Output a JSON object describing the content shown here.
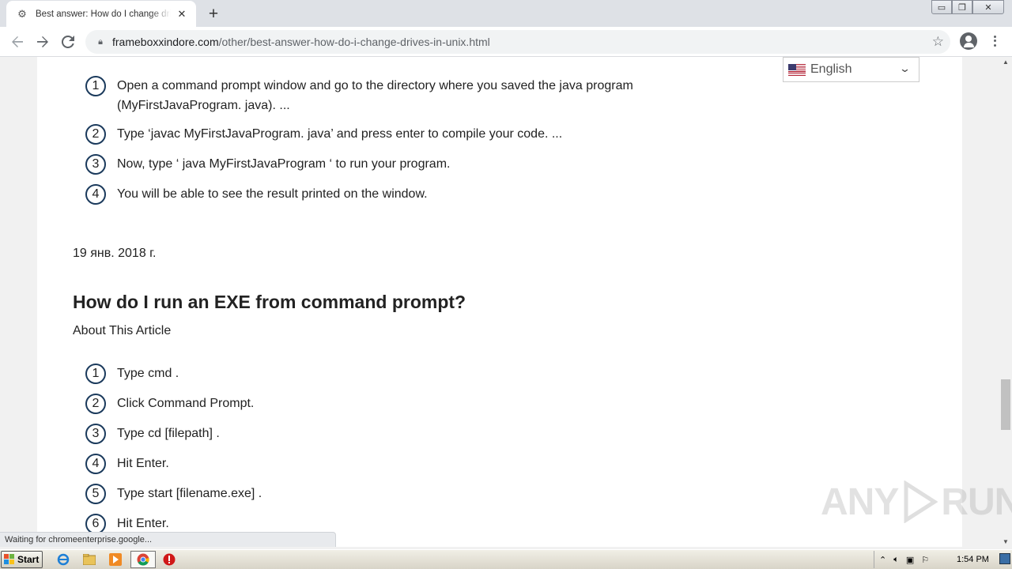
{
  "browser": {
    "tab_title": "Best answer: How do I change drives in unix",
    "new_tab_symbol": "+",
    "url_host": "frameboxxindore.com",
    "url_path": "/other/best-answer-how-do-i-change-drives-in-unix.html",
    "status_text": "Waiting for chromeenterprise.google..."
  },
  "language_selector": {
    "label": "English"
  },
  "article": {
    "steps_top": [
      {
        "n": "1",
        "text": "Open a command prompt window and go to the directory where you saved the java program (MyFirstJavaProgram. java). ..."
      },
      {
        "n": "2",
        "text": "Type ‘javac MyFirstJavaProgram. java’ and press enter to compile your code. ..."
      },
      {
        "n": "3",
        "text": "Now, type ‘ java MyFirstJavaProgram ‘ to run your program."
      },
      {
        "n": "4",
        "text": "You will be able to see the result printed on the window."
      }
    ],
    "date": "19 янв. 2018 г.",
    "heading": "How do I run an EXE from command prompt?",
    "about": "About This Article",
    "steps_bottom": [
      {
        "n": "1",
        "text": "Type cmd ."
      },
      {
        "n": "2",
        "text": "Click Command Prompt."
      },
      {
        "n": "3",
        "text": "Type cd [filepath] ."
      },
      {
        "n": "4",
        "text": "Hit Enter."
      },
      {
        "n": "5",
        "text": "Type start [filename.exe] ."
      },
      {
        "n": "6",
        "text": "Hit Enter."
      }
    ]
  },
  "watermark": {
    "left": "ANY",
    "right": "RUN"
  },
  "taskbar": {
    "start_label": "Start",
    "clock": "1:54 PM"
  }
}
